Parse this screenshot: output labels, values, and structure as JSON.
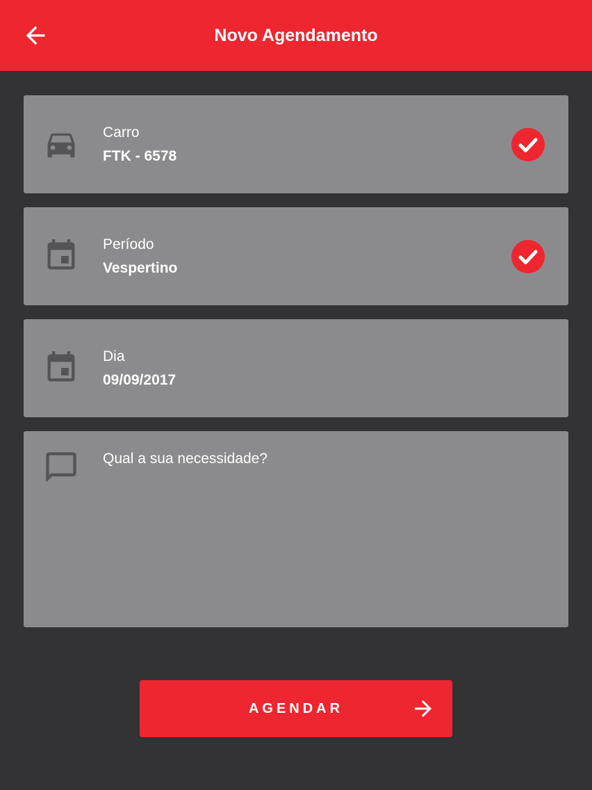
{
  "header": {
    "title": "Novo Agendamento",
    "back_icon": "arrow-back-icon",
    "background": "#ED2630"
  },
  "form": {
    "car": {
      "label": "Carro",
      "value": "FTK - 6578",
      "icon": "car-icon",
      "selected": true
    },
    "period": {
      "label": "Período",
      "value": "Vespertino",
      "icon": "calendar-icon",
      "selected": true
    },
    "day": {
      "label": "Dia",
      "value": "09/09/2017",
      "icon": "calendar-icon",
      "selected": false
    },
    "message": {
      "placeholder": "Qual a sua necessidade?",
      "value": "",
      "icon": "chat-bubble-icon"
    }
  },
  "submit": {
    "label": "AGENDAR",
    "icon": "arrow-forward-icon"
  },
  "colors": {
    "accent": "#ED2630",
    "background": "#333234",
    "card": "#8B8B8D",
    "icon": "#545456"
  }
}
